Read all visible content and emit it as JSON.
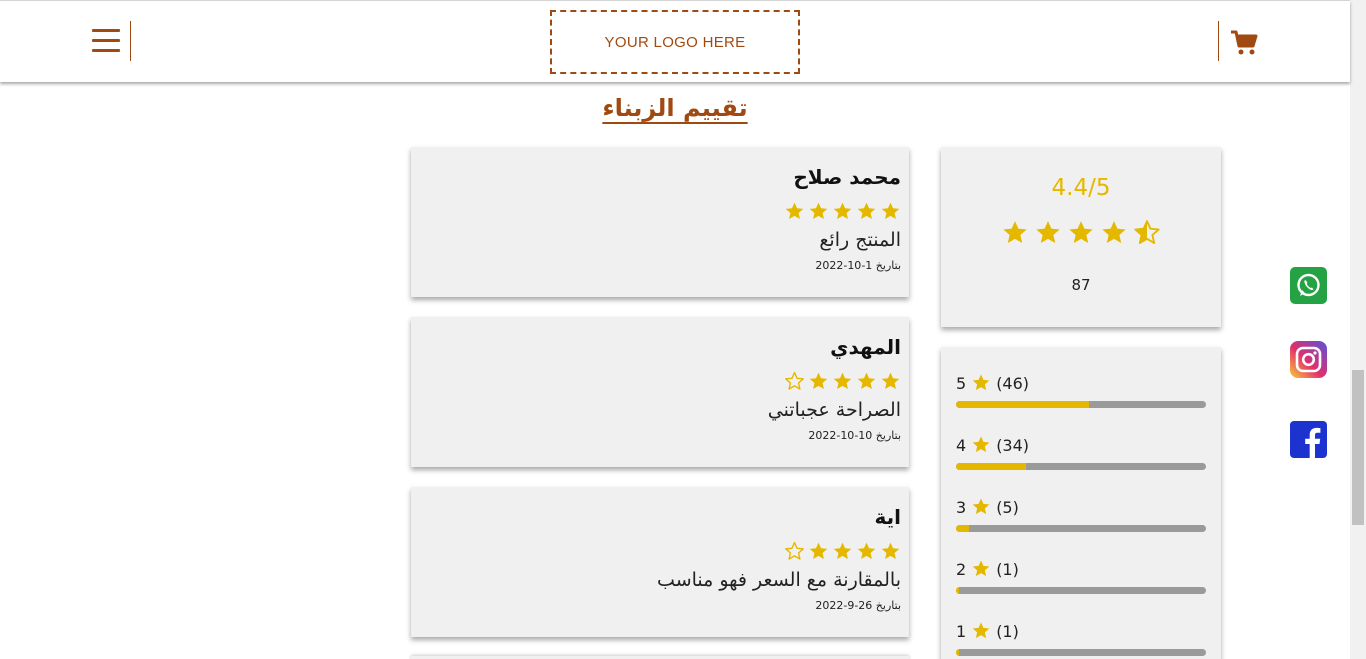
{
  "header": {
    "logo_text": "YOUR LOGO HERE",
    "menu_icon": "hamburger-menu-icon",
    "cart_icon": "shopping-cart-icon"
  },
  "section": {
    "title": "تقييم الزبناء"
  },
  "summary": {
    "score": "4.4/5",
    "rating": 4.4,
    "reviews_count": "87"
  },
  "breakdown": [
    {
      "stars": "5",
      "count": "(46)",
      "fraction": 0.53
    },
    {
      "stars": "4",
      "count": "(34)",
      "fraction": 0.28
    },
    {
      "stars": "3",
      "count": "(5)",
      "fraction": 0.05
    },
    {
      "stars": "2",
      "count": "(1)",
      "fraction": 0.01
    },
    {
      "stars": "1",
      "count": "(1)",
      "fraction": 0.01
    }
  ],
  "reviews": [
    {
      "name": "محمد صلاح",
      "rating": 5,
      "text": "المنتج رائع",
      "date": "بتاريخ 1-10-2022"
    },
    {
      "name": "المهدي",
      "rating": 4,
      "text": "الصراحة عجباتني",
      "date": "بتاريخ 10-10-2022"
    },
    {
      "name": "اية",
      "rating": 4,
      "text": "بالمقارنة مع السعر فهو مناسب",
      "date": "بتاريخ 26-9-2022"
    }
  ],
  "social": [
    {
      "name": "whatsapp-icon",
      "color": "#25a244"
    },
    {
      "name": "instagram-icon",
      "color": "#c13584"
    },
    {
      "name": "facebook-icon",
      "color": "#1d33cf"
    }
  ],
  "colors": {
    "brand": "#a04a12",
    "star": "#e5b800",
    "card": "#f0f0f0",
    "bar_track": "#9a9a9a"
  }
}
